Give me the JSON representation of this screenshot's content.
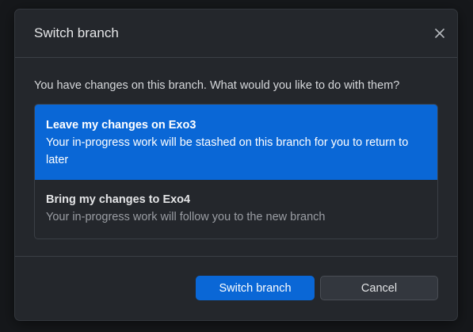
{
  "dialog": {
    "title": "Switch branch",
    "close_icon": "close-icon",
    "prompt": "You have changes on this branch. What would you like to do with them?",
    "options": [
      {
        "title": "Leave my changes on Exo3",
        "description": "Your in-progress work will be stashed on this branch for you to return to later",
        "selected": true
      },
      {
        "title": "Bring my changes to Exo4",
        "description": "Your in-progress work will follow you to the new branch",
        "selected": false
      }
    ],
    "primary_button": "Switch branch",
    "secondary_button": "Cancel"
  },
  "colors": {
    "accent": "#0a67d6",
    "dialog_bg": "#24272c",
    "backdrop": "#16181b"
  }
}
